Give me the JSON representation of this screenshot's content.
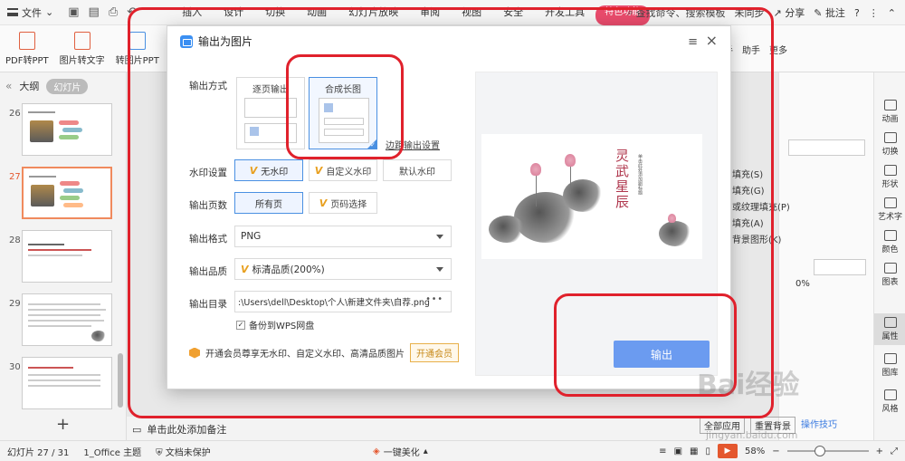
{
  "menubar": {
    "file_label": "文件",
    "tabs": [
      "插入",
      "设计",
      "切换",
      "动画",
      "幻灯片放映",
      "审阅",
      "视图",
      "安全",
      "开发工具"
    ],
    "special_tab": "特色功能",
    "search_label": "查找命令、搜索模板",
    "user_label": "未同步",
    "share_label": "分享",
    "comment_label": "批注"
  },
  "ribbon": {
    "buttons": [
      "PDF转PPT",
      "图片转文字",
      "转图片PPT",
      "输"
    ],
    "right_items": [
      "助手",
      "助手",
      "更多"
    ]
  },
  "leftpanel": {
    "tab_outline": "大纲",
    "tab_slides": "幻灯片",
    "slide_numbers": [
      "26",
      "27",
      "28",
      "29",
      "30"
    ],
    "add_symbol": "+"
  },
  "notes": {
    "placeholder": "单击此处添加备注"
  },
  "rightpanel": {
    "fill_options": [
      "填充(S)",
      "填充(G)",
      "或纹理填充(P)",
      "填充(A)",
      "背景图形(K)"
    ],
    "percent": "0%",
    "apply_all": "全部应用",
    "reset_bg": "重置背景",
    "tips": "操作技巧"
  },
  "rightbar": {
    "items": [
      "动画",
      "切换",
      "形状",
      "艺术字",
      "颜色",
      "图表",
      "属性",
      "图库",
      "风格"
    ]
  },
  "statusbar": {
    "slide_info": "幻灯片 27 / 31",
    "theme": "1_Office 主题",
    "protect": "文档未保护",
    "beautify": "一键美化",
    "zoom": "58%"
  },
  "dialog": {
    "title": "输出为图片",
    "labels": {
      "mode": "输出方式",
      "watermark": "水印设置",
      "pages": "输出页数",
      "format": "输出格式",
      "quality": "输出品质",
      "directory": "输出目录"
    },
    "mode_options": [
      "逐页输出",
      "合成长图"
    ],
    "margin_link": "边距输出设置",
    "watermark_options": [
      "无水印",
      "自定义水印",
      "默认水印"
    ],
    "page_options": [
      "所有页",
      "页码选择"
    ],
    "format_value": "PNG",
    "quality_value": "标清品质(200%)",
    "directory_value": ":\\Users\\dell\\Desktop\\个人\\新建文件夹\\自荐.png",
    "directory_more": "•••",
    "backup_label": "备份到WPS网盘",
    "member_text": "开通会员尊享无水印、自定义水印、高清品质图片",
    "member_button": "开通会员",
    "export_button": "输出",
    "preview": {
      "title": "灵武星辰",
      "subtitle": "单击此处添加副标题"
    }
  },
  "watermark": {
    "brand": "Bai经验",
    "url": "jingyan.baidu.com"
  },
  "colors": {
    "accent_blue": "#4a90e2",
    "export_button": "#6b9bf0",
    "annotation_red": "#e0212c",
    "selected_slide": "#f08a5d"
  }
}
